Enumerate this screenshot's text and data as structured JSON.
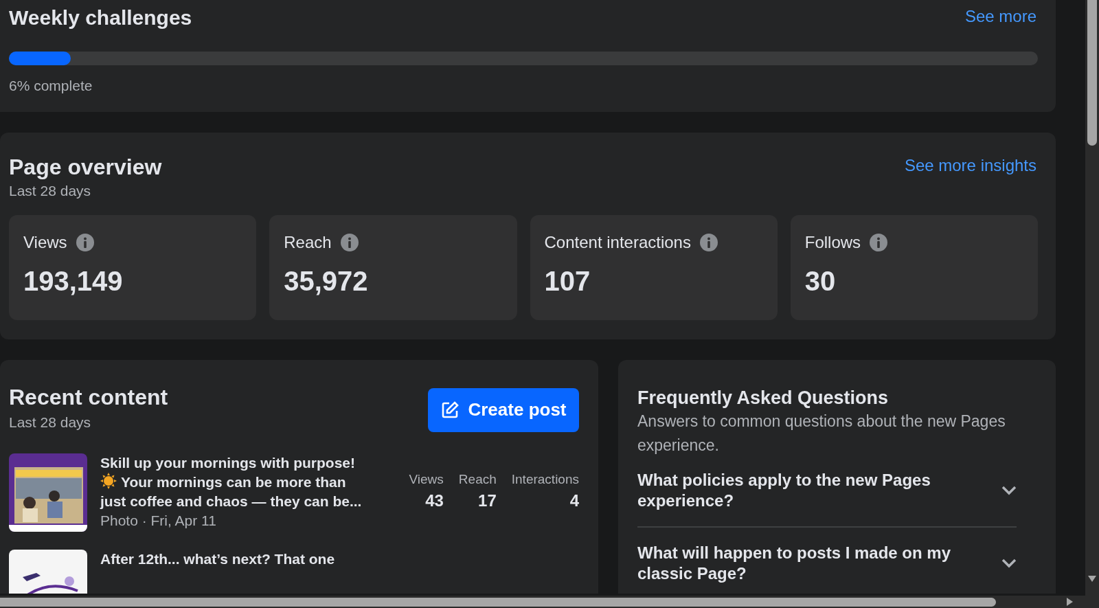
{
  "weekly_challenges": {
    "title": "Weekly challenges",
    "link": "See more",
    "progress": {
      "level": 0.06,
      "label": "6% complete"
    }
  },
  "page_overview": {
    "title": "Page overview",
    "link": "See more insights",
    "subtitle": "Last 28 days",
    "stats": [
      {
        "label": "Views",
        "value": "193,149"
      },
      {
        "label": "Reach",
        "value": "35,972"
      },
      {
        "label": "Content interactions",
        "value": "107"
      },
      {
        "label": "Follows",
        "value": "30"
      }
    ]
  },
  "recent_content": {
    "title": "Recent content",
    "subtitle": "Last 28 days",
    "button": "Create post",
    "posts": [
      {
        "caption": [
          "Skill up your mornings with purpose!",
          "Your mornings can be more than",
          "just coffee and chaos — they can be..."
        ],
        "meta": "Photo · Fri, Apr 11",
        "stats": [
          {
            "label": "Views",
            "value": "43"
          },
          {
            "label": "Reach",
            "value": "17"
          },
          {
            "label": "Interactions",
            "value": "4"
          }
        ]
      },
      {
        "caption": [
          "After 12th... what’s next? That one"
        ]
      }
    ]
  },
  "faq": {
    "title": "Frequently Asked Questions",
    "subtitle": "Answers to common questions about the new Pages experience.",
    "questions": [
      {
        "text": "What policies apply to the new Pages experience?",
        "expanded": false
      },
      {
        "text": "What will happen to posts I made on my classic Page?",
        "expanded": false
      }
    ]
  }
}
